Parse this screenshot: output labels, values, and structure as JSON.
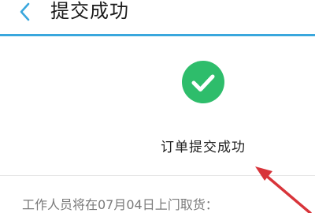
{
  "header": {
    "title": "提交成功",
    "back_icon": "chevron-left-icon"
  },
  "result": {
    "icon": "check-circle-icon",
    "message": "订单提交成功"
  },
  "notice": {
    "text": "工作人员将在07月04日上门取货："
  },
  "colors": {
    "accent": "#3aa7dd",
    "success": "#2ebd6b",
    "annotation_arrow": "#d8343a"
  }
}
